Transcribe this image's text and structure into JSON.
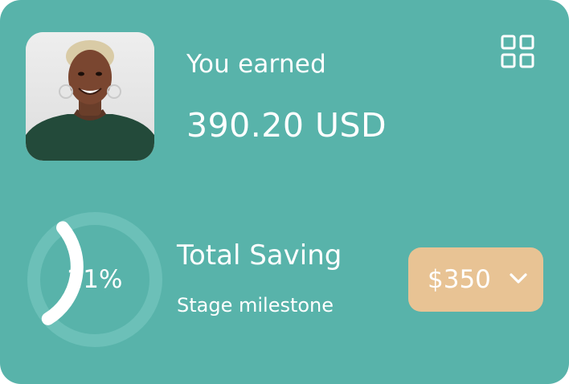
{
  "earnings": {
    "label": "You earned",
    "amount": "390.20 USD"
  },
  "profile": {
    "avatar_description": "profile-photo"
  },
  "menu": {
    "icon": "grid-icon"
  },
  "savings": {
    "progress_text": "21%",
    "progress_fraction": 0.21,
    "title": "Total Saving",
    "subtitle": "Stage milestone",
    "amount": "$350",
    "dropdown_icon": "chevron-down-icon"
  },
  "colors": {
    "card_background": "#58b3aa",
    "ring_track": "#6cc0b8",
    "ring_progress": "#ffffff",
    "amount_button": "#e8c394",
    "text": "#ffffff"
  }
}
